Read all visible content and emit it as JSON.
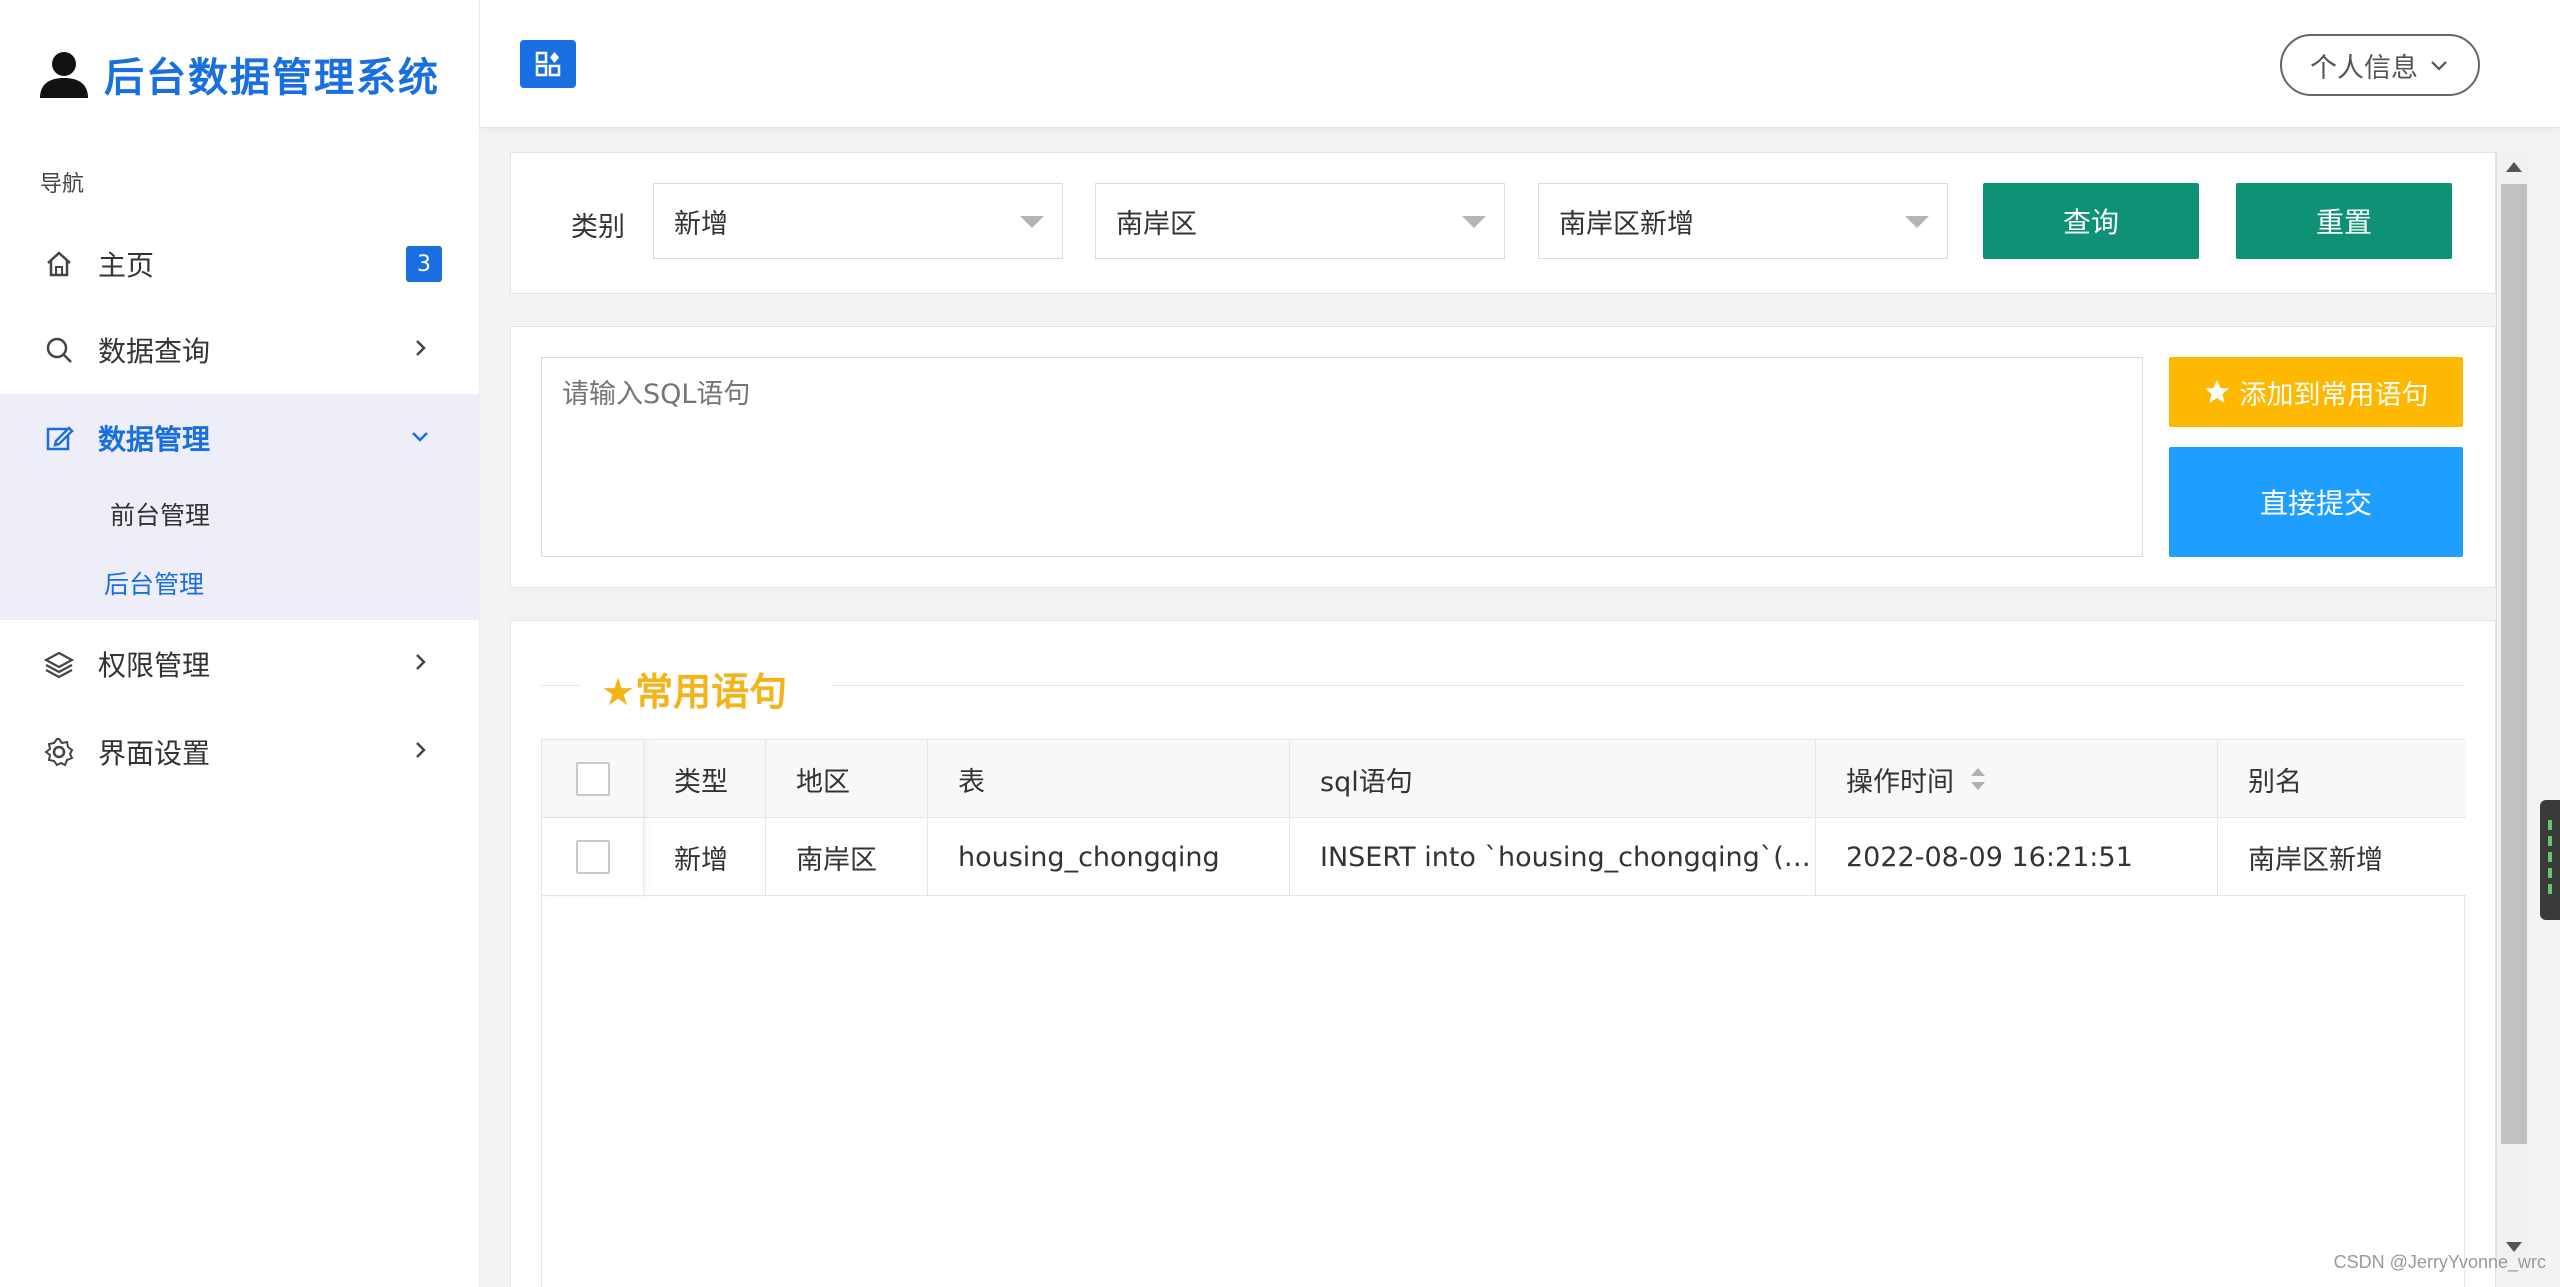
{
  "sidebar": {
    "brand_title": "后台数据管理系统",
    "nav_caption": "导航",
    "items": [
      {
        "label": "主页",
        "badge": "3",
        "icon": "home-icon"
      },
      {
        "label": "数据查询",
        "icon": "search-icon"
      },
      {
        "label": "数据管理",
        "icon": "edit-icon",
        "expanded": true,
        "children": [
          {
            "label": "前台管理"
          },
          {
            "label": "后台管理",
            "active": true
          }
        ]
      },
      {
        "label": "权限管理",
        "icon": "layers-icon"
      },
      {
        "label": "界面设置",
        "icon": "gear-icon"
      }
    ]
  },
  "header": {
    "toggle_icon": "grid-toggle-icon",
    "profile_label": "个人信息"
  },
  "filters": {
    "label": "类别",
    "category_value": "新增",
    "region_value": "南岸区",
    "alias_value": "南岸区新增",
    "query_label": "查询",
    "reset_label": "重置"
  },
  "sql": {
    "placeholder": "请输入SQL语句",
    "add_common_label": "添加到常用语句",
    "submit_label": "直接提交"
  },
  "common": {
    "title": "★常用语句",
    "columns": [
      "类型",
      "地区",
      "表",
      "sql语句",
      "操作时间",
      "别名"
    ],
    "rows": [
      {
        "type": "新增",
        "region": "南岸区",
        "table": "housing_chongqing",
        "sql": "INSERT into `housing_chongqing`(…",
        "time": "2022-08-09 16:21:51",
        "alias": "南岸区新增"
      }
    ]
  },
  "watermark": "CSDN @JerryYvonne_wrc",
  "colors": {
    "primary": "#1a6fe0",
    "teal": "#0f9176",
    "yellow": "#ffb800",
    "blue": "#1e9fff",
    "title_gold": "#f5b31a"
  }
}
